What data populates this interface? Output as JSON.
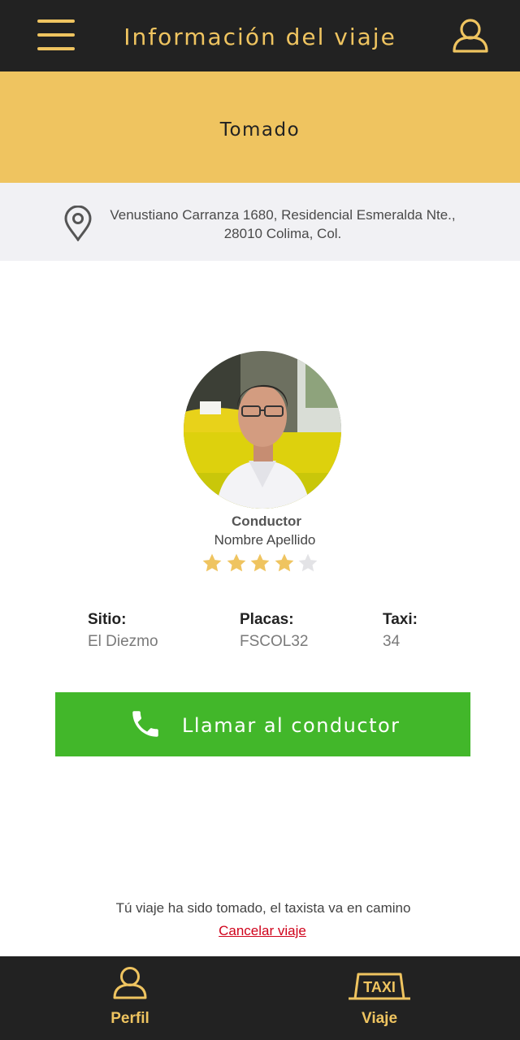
{
  "header": {
    "title": "Información del viaje",
    "menu_icon": "hamburger-menu-icon",
    "profile_icon": "user-icon"
  },
  "status": {
    "label": "Tomado",
    "color": "#efc460"
  },
  "address": {
    "icon": "map-pin-icon",
    "line1": "Venustiano Carranza 1680, Residencial Esmeralda Nte.,",
    "line2": "28010 Colima, Col."
  },
  "driver": {
    "role": "Conductor",
    "name": "Nombre Apellido",
    "rating": 4,
    "rating_max": 5
  },
  "trip_info": [
    {
      "label": "Sitio:",
      "value": "El Diezmo"
    },
    {
      "label": "Placas:",
      "value": "FSCOL32"
    },
    {
      "label": "Taxi:",
      "value": "34"
    }
  ],
  "call_button": {
    "label": "Llamar al conductor",
    "icon": "phone-icon",
    "color": "#42b72a"
  },
  "footer": {
    "message": "Tú viaje ha sido tomado, el taxista va en camino",
    "cancel_label": "Cancelar viaje"
  },
  "bottom_nav": [
    {
      "label": "Perfil",
      "icon": "user-icon"
    },
    {
      "label": "Viaje",
      "icon": "taxi-sign-icon",
      "sign_text": "TAXI"
    }
  ],
  "colors": {
    "dark": "#222222",
    "accent": "#efc460",
    "cancel": "#d0021b"
  }
}
